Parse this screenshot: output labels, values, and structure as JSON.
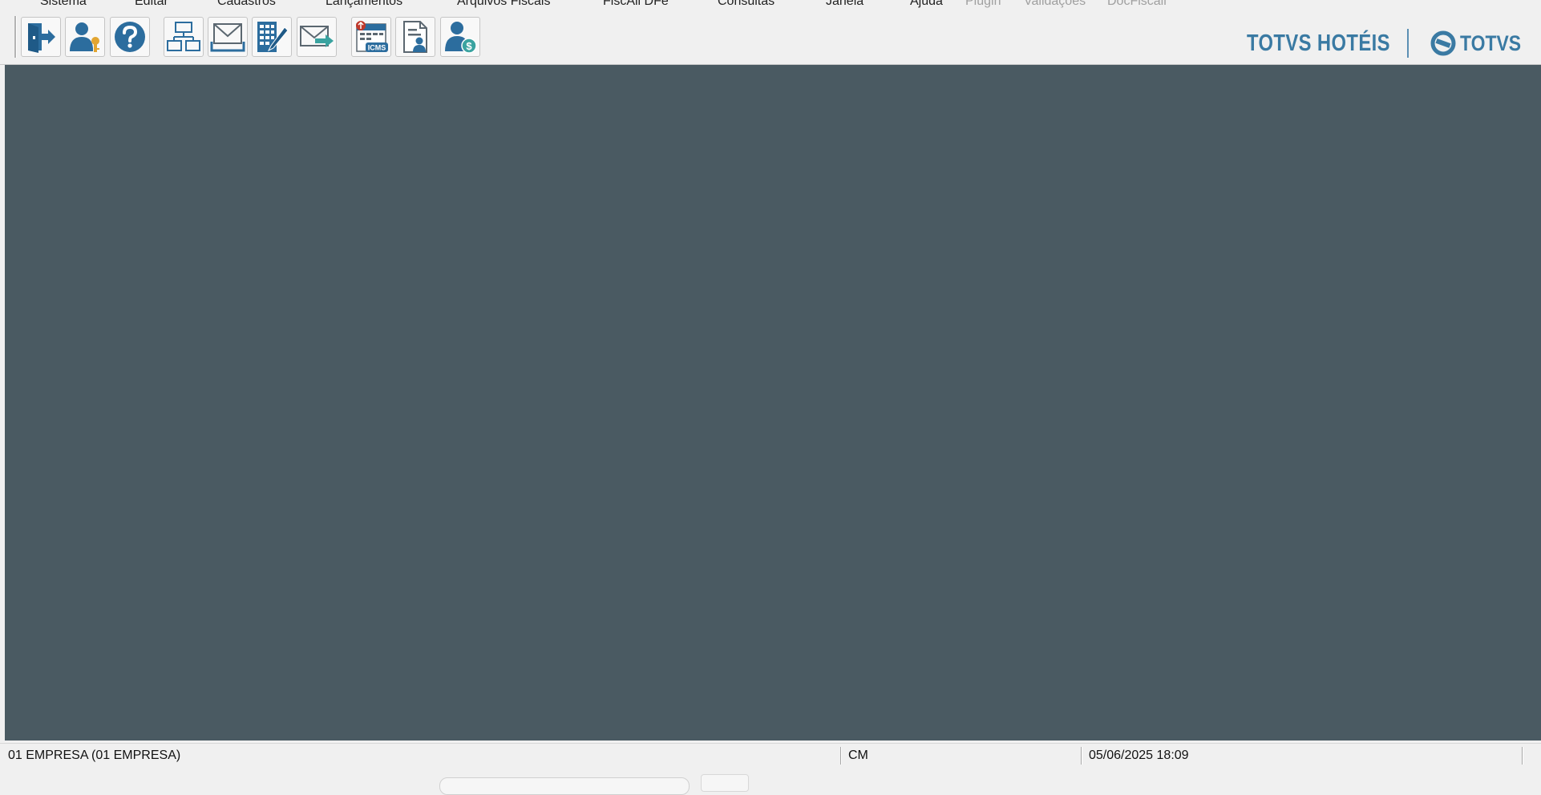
{
  "menu": {
    "items": [
      {
        "label": "Sistema",
        "enabled": true
      },
      {
        "label": "Editar",
        "enabled": true
      },
      {
        "label": "Cadastros",
        "enabled": true
      },
      {
        "label": "Lançamentos",
        "enabled": true
      },
      {
        "label": "Arquivos Fiscais",
        "enabled": true
      },
      {
        "label": "FiscAll DFe",
        "enabled": true
      },
      {
        "label": "Consultas",
        "enabled": true
      },
      {
        "label": "Janela",
        "enabled": true
      },
      {
        "label": "Ajuda",
        "enabled": true
      },
      {
        "label": "Plugin",
        "enabled": false
      },
      {
        "label": "Validações",
        "enabled": false
      },
      {
        "label": "DocFiscall",
        "enabled": false
      }
    ]
  },
  "toolbar": {
    "buttons": [
      {
        "icon": "exit-door-icon"
      },
      {
        "icon": "user-key-icon"
      },
      {
        "icon": "help-icon"
      },
      {
        "icon": "org-structure-icon"
      },
      {
        "icon": "envelope-icon"
      },
      {
        "icon": "spreadsheet-edit-icon"
      },
      {
        "icon": "send-mail-icon"
      },
      {
        "icon": "icms-calendar-icon",
        "badge_text": "ICMS"
      },
      {
        "icon": "document-user-icon"
      },
      {
        "icon": "user-dollar-icon"
      }
    ]
  },
  "branding": {
    "product": "TOTVS HOTÉIS",
    "company": "TOTVS",
    "color": "#3a7aa3"
  },
  "workspace": {
    "background": "#4a5a62"
  },
  "statusbar": {
    "company": "01 EMPRESA (01 EMPRESA)",
    "code": "CM",
    "datetime": "05/06/2025 18:09"
  }
}
